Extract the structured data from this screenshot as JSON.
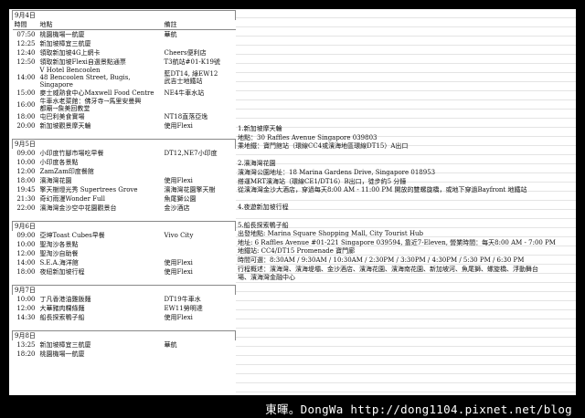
{
  "days": [
    {
      "date": "9月4日",
      "header": {
        "time": "時間",
        "place": "地點",
        "note": "備註"
      },
      "rows": [
        {
          "time": "07:50",
          "place": "桃園機場一航廈",
          "note": "華航"
        },
        {
          "time": "12:25",
          "place": "新加坡樟宜三航廈",
          "note": ""
        },
        {
          "time": "12:40",
          "place": "領取新加坡4G上網卡",
          "note": "Cheers便利店"
        },
        {
          "time": "12:50",
          "place": "領取新加坡Flexi自選景點通票",
          "note": "T3航站#01-K19號"
        },
        {
          "time": "14:00",
          "place": "V Hotel Bencoolen\n48 Bencoolen Street, Bugis, Singapore",
          "note": "藍DT14, 綠EW12\n武吉士地鐵站",
          "tall": true
        },
        {
          "time": "15:00",
          "place": "麥士威熟食中心Maxwell Food Centre",
          "note": "NE4牛車水站"
        },
        {
          "time": "16:00",
          "place": "牛車水老菜館：佛牙寺→馬里安曼興\n都廟→詹美回教堂",
          "note": "",
          "tall": true
        },
        {
          "time": "18:00",
          "place": "屯巴利美食實場",
          "note": "NT18直落亞逸"
        },
        {
          "time": "20:00",
          "place": "新加坡觀景摩天輪",
          "note": "使用Flexi"
        }
      ]
    },
    {
      "date": "9月5日",
      "rows": [
        {
          "time": "09:00",
          "place": "小印度竹腳市場吃早餐",
          "note": "DT12,NE7小印度"
        },
        {
          "time": "10:00",
          "place": "小印度各景點",
          "note": ""
        },
        {
          "time": "12:00",
          "place": "ZamZam印度餐館",
          "note": ""
        },
        {
          "time": "18:00",
          "place": "濱海灣花園",
          "note": "使用Flexi"
        },
        {
          "time": "19:45",
          "place": "擎天樹燈光秀 Supertrees Grove",
          "note": "濱海灣花園擎天樹"
        },
        {
          "time": "21:30",
          "place": "奇幻雨漫Wonder Full",
          "note": "魚尾獅公園"
        },
        {
          "time": "22:00",
          "place": "濱海灣金沙空中花園觀景台",
          "note": "金沙酒店"
        }
      ]
    },
    {
      "date": "9月6日",
      "rows": [
        {
          "time": "09:00",
          "place": "亞坤Toast Cubes早餐",
          "note": "Vivo City"
        },
        {
          "time": "10:00",
          "place": "聖淘沙各景點",
          "note": ""
        },
        {
          "time": "12:00",
          "place": "聖淘沙自助餐",
          "note": ""
        },
        {
          "time": "14:00",
          "place": "S.E.A.海洋館",
          "note": "使用Flexi"
        },
        {
          "time": "18:00",
          "place": "夜紐新加坡行程",
          "note": "使用Flexi"
        }
      ]
    },
    {
      "date": "9月7日",
      "rows": [
        {
          "time": "10:00",
          "place": "丁凡香港油雞飯麵",
          "note": "DT19牛車水"
        },
        {
          "time": "12:00",
          "place": "大華豬肉粿條麵",
          "note": "EW11勞明達"
        },
        {
          "time": "14:30",
          "place": "船長探索鴨子船",
          "note": "使用Flexi"
        }
      ]
    },
    {
      "date": "9月8日",
      "rows": [
        {
          "time": "13:25",
          "place": "新加坡樟宜三航廈",
          "note": "華航"
        },
        {
          "time": "18:20",
          "place": "桃園機場一航廈",
          "note": ""
        }
      ]
    }
  ],
  "notes": [
    {
      "lines": [
        "1.新加坡摩天輪",
        "地點：30 Raffles Avenue Singapore 039803",
        "乘地鐵：寶門館站（環線CC4或濱海地區環線DT15）A出口"
      ]
    },
    {
      "lines": [
        "2.濱海灣花園",
        "濱海灣公園地址：18 Marina Gardens Drive, Singapore 018953",
        "搭運MRT濱海站（環線CE1/DT16）B出口，徒步約5 分鐘",
        "從濱海灣金沙大酒店，穿過每天8:00 AM - 11:00 PM 開放的雙螺旋橋，或地下穿過Bayfront 地鐵站"
      ]
    },
    {
      "lines": [
        "4.夜遊新加坡行程"
      ]
    },
    {
      "lines": [
        "5.船長探索鴨子船",
        "出發地點: Marina Square Shopping Mall, City Tourist Hub",
        "地址: 6 Raffles Avenue #01-221 Singapore 039594, 靠近7-Eleven, 營業時間：每天8:00 AM - 7:00 PM",
        "地鐵站: CC4/DT15 Promenade 寶門廊",
        "時間可選：8:30AM / 9:30AM / 10:30AM / 2:30PM / 3:30PM / 4:30PM / 5:30 PM / 6:30 PM",
        "行程概述：濱海灣、濱海堤壩、金沙酒店、濱海花園、濱海南花園、新加坡河、魚尾獅、螺旋橋、浮動舞台",
        "場、濱海灣金融中心"
      ]
    }
  ],
  "watermark": "東暉。DongWa http://dong1104.pixnet.net/blog"
}
